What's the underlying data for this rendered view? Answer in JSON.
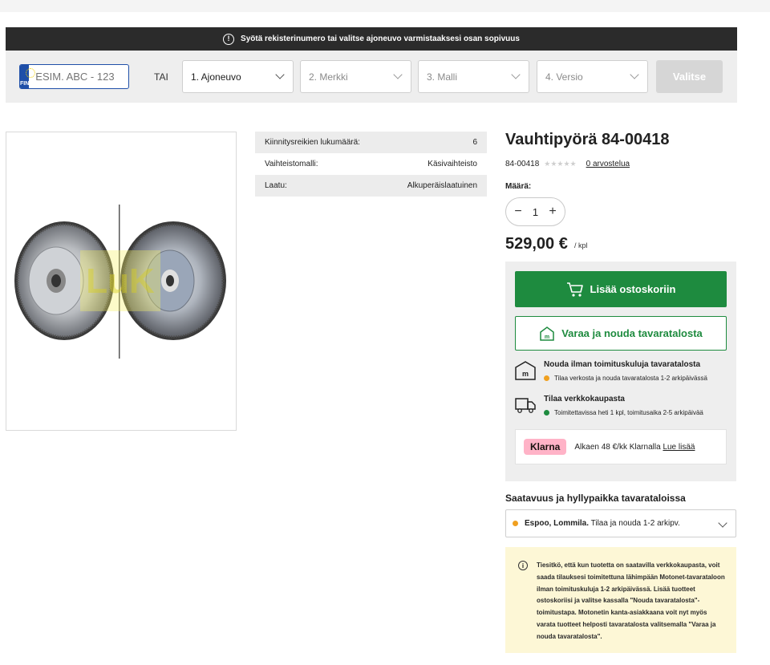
{
  "banner": {
    "text": "Syötä rekisterinumero tai valitse ajoneuvo varmistaaksesi osan sopivuus"
  },
  "vehicle_selector": {
    "plate_country": "FIN",
    "plate_placeholder": "ESIM. ABC - 123",
    "or_label": "TAI",
    "dropdowns": [
      "1. Ajoneuvo",
      "2. Merkki",
      "3. Malli",
      "4. Versio"
    ],
    "submit_label": "Valitse"
  },
  "specs": [
    {
      "label": "Kiinnitysreikien lukumäärä:",
      "value": "6"
    },
    {
      "label": "Vaihteistomalli:",
      "value": "Käsivaihteisto"
    },
    {
      "label": "Laatu:",
      "value": "Alkuperäislaatuinen"
    }
  ],
  "product": {
    "title": "Vauhtipyörä 84-00418",
    "sku": "84-00418",
    "rating": 0,
    "reviews_label": "0 arvostelua",
    "quantity_label": "Määrä:",
    "quantity": "1",
    "price": "529,00 €",
    "price_unit": "/ kpl"
  },
  "buy": {
    "add_to_cart_label": "Lisää ostoskoriin",
    "reserve_label": "Varaa ja nouda tavaratalosta",
    "pickup_title": "Nouda ilman toimituskuluja tavaratalosta",
    "pickup_sub": "Tilaa verkosta ja nouda tavaratalosta 1-2 arkipäivässä",
    "online_title": "Tilaa verkkokaupasta",
    "online_sub": "Toimitettavissa heti 1 kpl, toimitusaika 2-5 arkipäivää",
    "klarna_logo": "Klarna",
    "klarna_text": "Alkaen 48 €/kk Klarnalla",
    "klarna_link": "Lue lisää"
  },
  "availability": {
    "title": "Saatavuus ja hyllypaikka tavarataloissa",
    "store": "Espoo, Lommila.",
    "store_status": "Tilaa ja nouda 1-2 arkipv."
  },
  "tip": {
    "text": "Tiesitkö, että kun tuotetta on saatavilla verkkokaupasta, voit saada tilauksesi toimitettuna lähimpään Motonet-tavarataloon ilman toimituskuluja 1-2 arkipäivässä. Lisää tuotteet ostoskoriisi ja valitse kassalla \"Nouda tavaratalosta\"-toimitustapa. Motonetin kanta-asiakkaana voit nyt myös varata tuotteet helposti tavaratalosta valitsemalla \"Varaa ja nouda tavaratalosta\"."
  },
  "colors": {
    "primary_green": "#1e8b3f",
    "banner_dark": "#2b2b2b",
    "status_orange": "#f0a020",
    "status_green": "#1e8b3f",
    "klarna_pink": "#ffb3c7",
    "tip_yellow": "#fdf7d6"
  },
  "icons": [
    "info-icon",
    "eu-flag-icon",
    "chevron-down-icon",
    "cart-icon",
    "store-icon",
    "truck-icon",
    "minus-icon",
    "plus-icon"
  ]
}
